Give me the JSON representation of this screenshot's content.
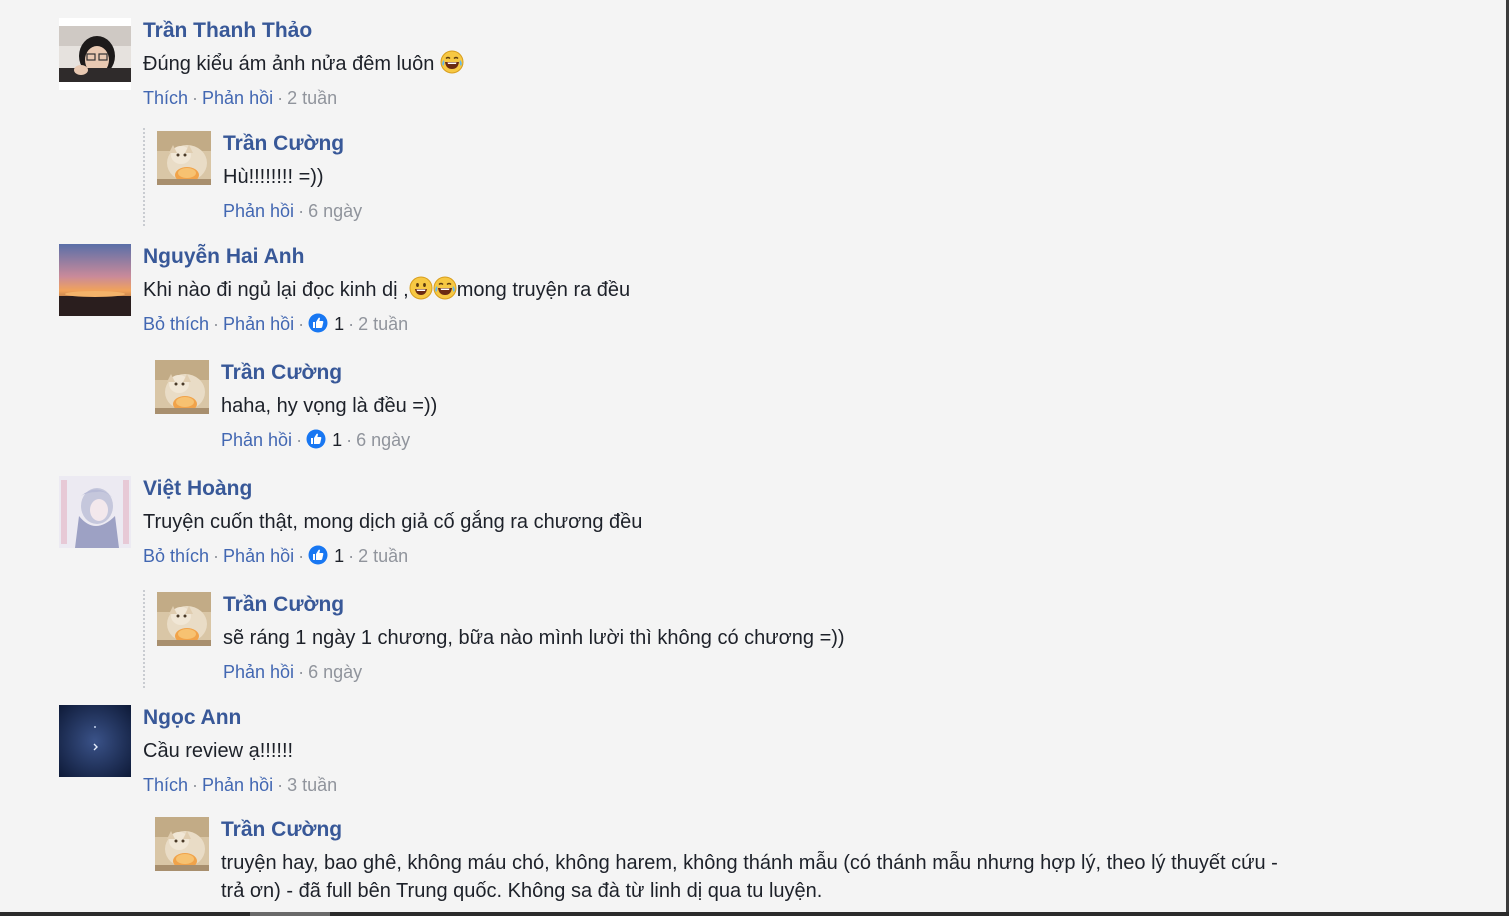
{
  "comments": [
    {
      "author": "Trần Thanh Thảo",
      "text": "Đúng kiểu ám ảnh nửa đêm luôn",
      "like_label": "Thích",
      "reply_label": "Phản hồi",
      "time": "2 tuần",
      "avatar_icon": "avatar-photo-girl-glasses",
      "reply": {
        "author": "Trần Cường",
        "text": "Hù!!!!!!!! =))",
        "reply_label": "Phản hồi",
        "time": "6 ngày"
      }
    },
    {
      "author": "Nguyễn Hai Anh",
      "text_before": "Khi nào đi ngủ lại đọc kinh dị ,",
      "text_after": "mong truyện ra đều",
      "like_label": "Bỏ thích",
      "reply_label": "Phản hồi",
      "like_count": "1",
      "time": "2 tuần",
      "avatar_icon": "avatar-photo-sunset",
      "reply": {
        "author": "Trần Cường",
        "text": "haha, hy vọng là đều =))",
        "reply_label": "Phản hồi",
        "like_count": "1",
        "time": "6 ngày"
      }
    },
    {
      "author": "Việt Hoàng",
      "text": "Truyện cuốn thật, mong dịch giả cố gắng ra chương đều",
      "like_label": "Bỏ thích",
      "reply_label": "Phản hồi",
      "like_count": "1",
      "time": "2 tuần",
      "avatar_icon": "avatar-anime-girl",
      "reply": {
        "author": "Trần Cường",
        "text": "sẽ ráng 1 ngày 1 chương, bữa nào mình lười thì không có chương =))",
        "reply_label": "Phản hồi",
        "time": "6 ngày"
      }
    },
    {
      "author": "Ngọc Ann",
      "text": "Cầu review ạ!!!!!!",
      "like_label": "Thích",
      "reply_label": "Phản hồi",
      "time": "3 tuần",
      "avatar_icon": "avatar-night-sky",
      "reply": {
        "author": "Trần Cường",
        "text": "truyện hay, bao ghê, không máu chó, không harem, không thánh mẫu (có thánh mẫu nhưng hợp lý, theo lý thuyết cứu - trả ơn) - đã full bên Trung quốc. Không sa đà từ linh dị qua tu luyện."
      }
    }
  ],
  "colors": {
    "background": "#f4f4f4",
    "author": "#385898",
    "link": "#4267b2",
    "meta": "#90949c",
    "text": "#1d2129",
    "like_badge": "#1877f2"
  },
  "icons": {
    "laugh_emoji": "laughing-tears-emoji-icon",
    "smile_emoji": "grinning-emoji-icon",
    "like_badge": "thumbs-up-icon",
    "reply_avatar": "avatar-photo-cat"
  }
}
